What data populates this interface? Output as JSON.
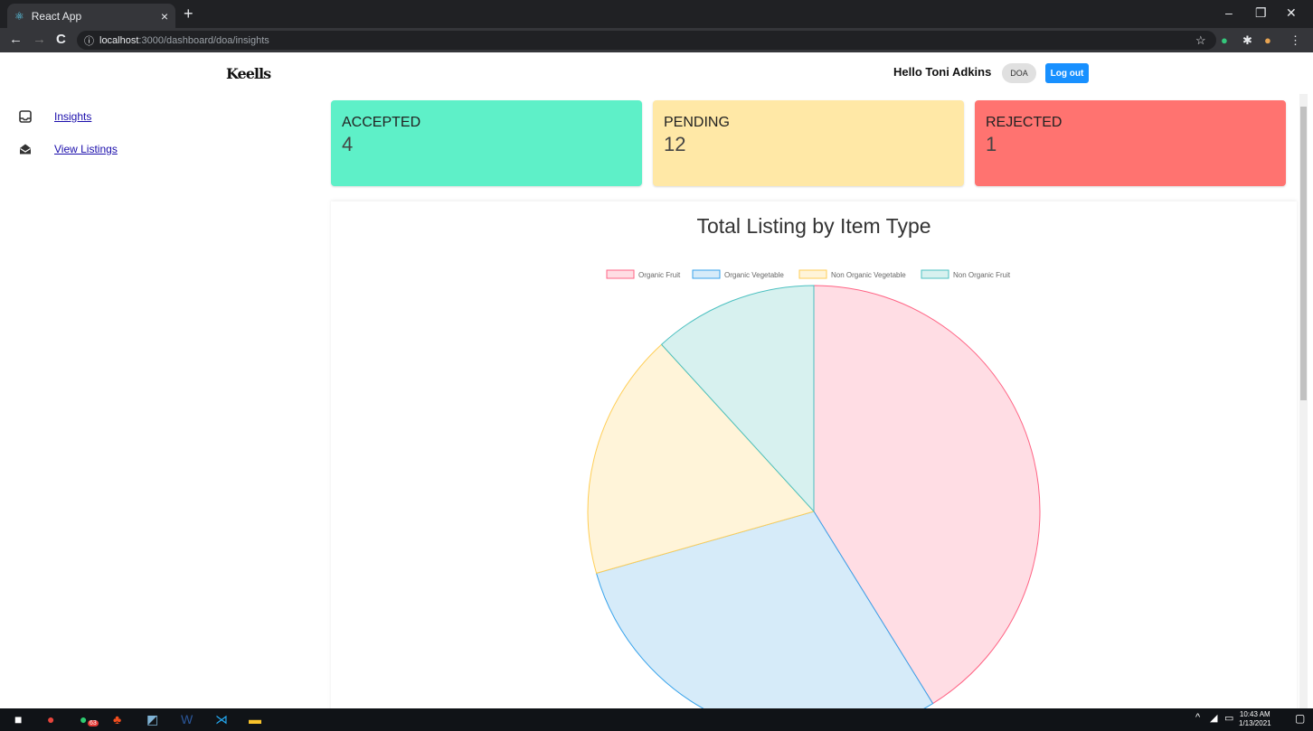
{
  "browser": {
    "tab_title": "React App",
    "tab_close": "×",
    "new_tab": "+",
    "url_host": "localhost",
    "url_path": ":3000/dashboard/doa/insights"
  },
  "header": {
    "logo": "Keells",
    "greeting": "Hello Toni Adkins",
    "role": "DOA",
    "logout_label": "Log out"
  },
  "sidebar": {
    "items": [
      {
        "label": "Insights",
        "icon": "inbox-icon"
      },
      {
        "label": "View Listings",
        "icon": "open-mail-icon"
      }
    ]
  },
  "stats": [
    {
      "label": "ACCEPTED",
      "value": "4",
      "color": "#5ef0c8"
    },
    {
      "label": "PENDING",
      "value": "12",
      "color": "#ffe8a6"
    },
    {
      "label": "REJECTED",
      "value": "1",
      "color": "#ff7370"
    }
  ],
  "chart_data": {
    "type": "pie",
    "title": "Total Listing by Item Type",
    "legend_position": "top",
    "categories": [
      "Organic Fruit",
      "Organic Vegetable",
      "Non Organic Vegetable",
      "Non Organic Fruit"
    ],
    "values": [
      7,
      5,
      3,
      2
    ],
    "fill_colors": [
      "#ffdde4",
      "#d6ebf9",
      "#fff4d9",
      "#d7f1ef"
    ],
    "stroke_colors": [
      "#ff6384",
      "#36a2eb",
      "#ffce56",
      "#4bc0c0"
    ]
  },
  "taskbar": {
    "time": "10:43 AM",
    "date": "1/13/2021",
    "badge": "63"
  }
}
